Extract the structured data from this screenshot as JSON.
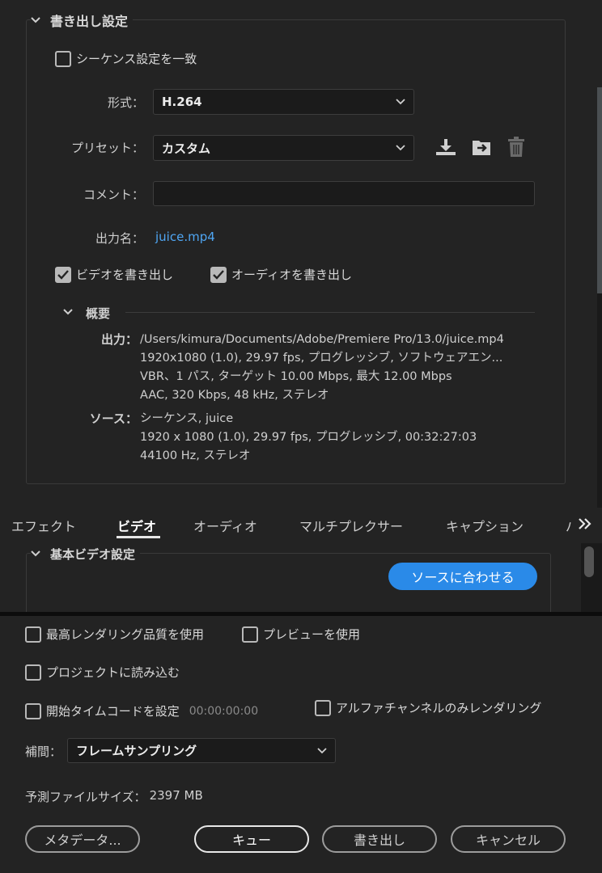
{
  "export_settings": {
    "title": "書き出し設定",
    "match_sequence_label": "シーケンス設定を一致",
    "match_sequence_checked": false,
    "format_label": "形式：",
    "format_value": "H.264",
    "preset_label": "プリセット：",
    "preset_value": "カスタム",
    "comment_label": "コメント：",
    "comment_value": "",
    "output_name_label": "出力名：",
    "output_name_value": "juice.mp4",
    "export_video_label": "ビデオを書き出し",
    "export_video_checked": true,
    "export_audio_label": "オーディオを書き出し",
    "export_audio_checked": true,
    "icons": [
      "save-preset-icon",
      "import-preset-icon",
      "delete-preset-icon"
    ]
  },
  "summary": {
    "title": "概要",
    "output_label": "出力：",
    "output_lines": [
      "/Users/kimura/Documents/Adobe/Premiere Pro/13.0/juice.mp4",
      "1920x1080 (1.0), 29.97 fps, プログレッシブ, ソフトウェアエン...",
      "VBR、1 パス, ターゲット 10.00 Mbps, 最大 12.00 Mbps",
      "AAC, 320 Kbps, 48 kHz, ステレオ"
    ],
    "source_label": "ソース：",
    "source_lines": [
      "シーケンス, juice",
      "1920 x 1080 (1.0), 29.97 fps, プログレッシブ, 00:32:27:03",
      "44100 Hz, ステレオ"
    ]
  },
  "tabs": {
    "items": [
      "エフェクト",
      "ビデオ",
      "オーディオ",
      "マルチプレクサー",
      "キャプション",
      "パ"
    ],
    "active": "ビデオ",
    "more_icon": "double-chevron-right-icon"
  },
  "video": {
    "basic_title": "基本ビデオ設定",
    "match_source_button": "ソースに合わせる"
  },
  "bottom": {
    "max_render_quality": "最高レンダリング品質を使用",
    "use_previews": "プレビューを使用",
    "import_into_project": "プロジェクトに読み込む",
    "set_start_timecode": "開始タイムコードを設定",
    "start_timecode_value": "00:00:00:00",
    "alpha_only": "アルファチャンネルのみレンダリング",
    "interpolation_label": "補間：",
    "interpolation_value": "フレームサンプリング",
    "estimated_size_label": "予測ファイルサイズ：",
    "estimated_size_value": "2397 MB"
  },
  "buttons": {
    "metadata": "メタデータ...",
    "queue": "キュー",
    "export": "書き出し",
    "cancel": "キャンセル"
  },
  "colors": {
    "background": "#232323",
    "accent_blue": "#2a8ae8",
    "link_blue": "#4fa6f3"
  }
}
